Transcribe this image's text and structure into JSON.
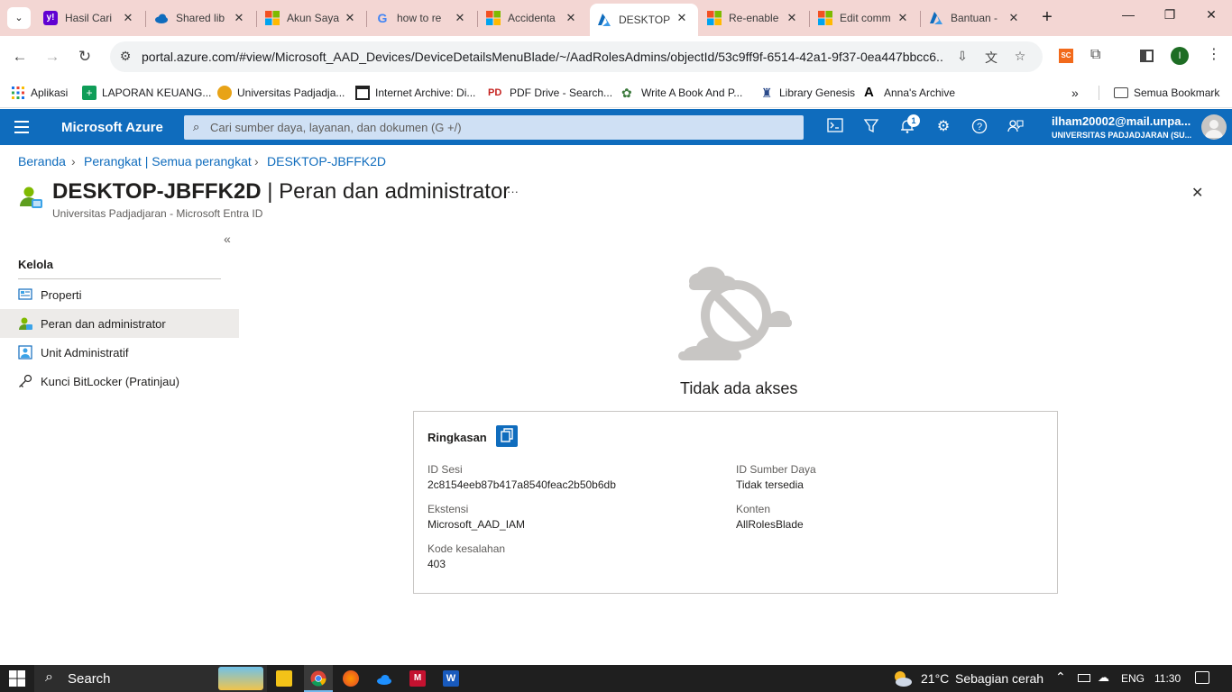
{
  "browser": {
    "tabs": [
      {
        "title": "Hasil Cari",
        "favicon": "yahoo-icon",
        "color": "#6001d2"
      },
      {
        "title": "Shared lib",
        "favicon": "onedrive-icon",
        "color": "#0f6cbd"
      },
      {
        "title": "Akun Saya",
        "favicon": "microsoft-icon",
        "color": "#f25022"
      },
      {
        "title": "how to re",
        "favicon": "google-icon",
        "color": "#4285f4"
      },
      {
        "title": "Accidenta",
        "favicon": "microsoft-icon",
        "color": "#f25022"
      },
      {
        "title": "DESKTOP",
        "favicon": "azure-icon",
        "color": "#0f6cbd"
      },
      {
        "title": "Re-enable",
        "favicon": "microsoft-icon",
        "color": "#f25022"
      },
      {
        "title": "Edit comm",
        "favicon": "microsoft-icon",
        "color": "#f25022"
      },
      {
        "title": "Bantuan -",
        "favicon": "azure-icon",
        "color": "#0f6cbd"
      }
    ],
    "active_tab_index": 5,
    "new_tab_label": "+",
    "url": "portal.azure.com/#view/Microsoft_AAD_Devices/DeviceDetailsMenuBlade/~/AadRolesAdmins/objectId/53c9ff9f-6514-42a1-9f37-0ea447bbcc6...",
    "extension_label": "SC",
    "profile_initial": "I",
    "bookmarks": [
      {
        "label": "Aplikasi",
        "icon": "apps-grid-icon"
      },
      {
        "label": "LAPORAN KEUANG...",
        "icon": "sheets-icon"
      },
      {
        "label": "Universitas Padjadja...",
        "icon": "unpad-icon"
      },
      {
        "label": "Internet Archive: Di...",
        "icon": "archive-icon"
      },
      {
        "label": "PDF Drive - Search...",
        "icon": "pdfdrive-icon"
      },
      {
        "label": "Write A Book And P...",
        "icon": "book-icon"
      },
      {
        "label": "Library Genesis",
        "icon": "libgen-icon"
      },
      {
        "label": "Anna's Archive",
        "icon": "anna-icon"
      }
    ],
    "bookmarks_overflow": "»",
    "all_bookmarks_label": "Semua Bookmark"
  },
  "azure": {
    "brand": "Microsoft Azure",
    "search_placeholder": "Cari sumber daya, layanan, dan dokumen (G +/)",
    "notification_count": "1",
    "user_email": "ilham20002@mail.unpa...",
    "user_org": "UNIVERSITAS PADJADJARAN (SU..."
  },
  "breadcrumb": [
    "Beranda",
    "Perangkat | Semua perangkat",
    "DESKTOP-JBFFK2D"
  ],
  "page": {
    "title_device": "DESKTOP-JBFFK2D",
    "title_rest": " | Peran dan administrator",
    "more_label": "···",
    "subtitle": "Universitas Padjadjaran - Microsoft Entra ID",
    "collapse_label": "«",
    "close_label": "✕"
  },
  "menu": {
    "section": "Kelola",
    "items": [
      {
        "label": "Properti",
        "icon": "properties-icon"
      },
      {
        "label": "Peran dan administrator",
        "icon": "roles-icon"
      },
      {
        "label": "Unit Administratif",
        "icon": "admin-unit-icon"
      },
      {
        "label": "Kunci BitLocker (Pratinjau)",
        "icon": "key-icon"
      }
    ],
    "selected_index": 1
  },
  "error": {
    "title": "Tidak ada akses",
    "summary_label": "Ringkasan",
    "fields": {
      "session_id_label": "ID Sesi",
      "session_id": "2c8154eeb87b417a8540feac2b50b6db",
      "resource_id_label": "ID Sumber Daya",
      "resource_id": "Tidak tersedia",
      "extension_label": "Ekstensi",
      "extension": "Microsoft_AAD_IAM",
      "content_label": "Konten",
      "content": "AllRolesBlade",
      "error_code_label": "Kode kesalahan",
      "error_code": "403"
    }
  },
  "taskbar": {
    "search_label": "Search",
    "weather_temp": "21°C",
    "weather_desc": "Sebagian cerah",
    "language": "ENG",
    "time": "11:30"
  },
  "colors": {
    "azure_blue": "#0f6cbd",
    "tab_strip": "#f3d6d3",
    "taskbar": "#1f1f1f"
  }
}
